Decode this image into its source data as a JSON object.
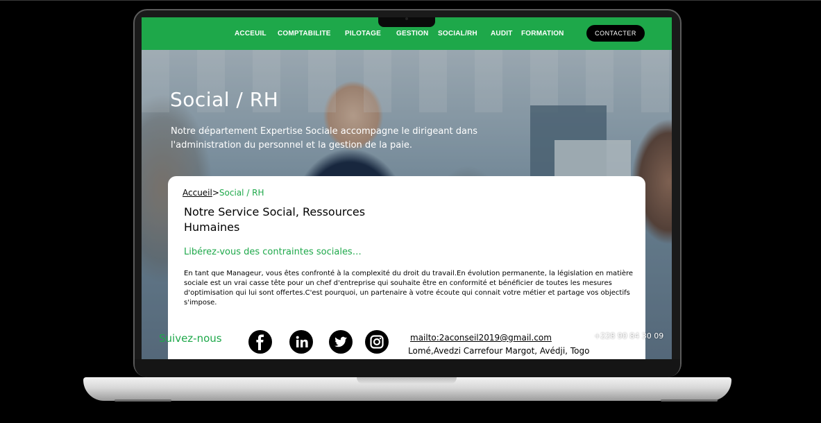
{
  "nav": {
    "items": [
      "ACCEUIL",
      "COMPTABILITE",
      "PILOTAGE",
      "GESTION",
      "SOCIAL/RH",
      "AUDIT",
      "FORMATION"
    ],
    "contact_label": "CONTACTER"
  },
  "hero": {
    "title": "Social / RH",
    "subtitle": "Notre département Expertise Sociale accompagne le dirigeant dans l'administration du personnel et la gestion de la paie."
  },
  "breadcrumb": {
    "home": "Accueil",
    "separator": ">",
    "current": "Social / RH"
  },
  "card": {
    "title": "Notre Service Social, Ressources Humaines",
    "tagline": "Libérez-vous des contraintes sociales…",
    "body": "En tant que Manageur, vous êtes confronté à la complexité du droit du travail.En évolution permanente, la législation en matière sociale est un vrai casse tête pour un chef d'entreprise qui souhaite être en conformité et bénéficier de toutes les mesures d'optimisation qui lui sont offertes.C'est pourquoi, un partenaire à votre écoute qui connait votre métier et partage vos objectifs s'impose."
  },
  "footer": {
    "follow_label": "Suivez-nous",
    "social_icons": [
      "facebook-icon",
      "linkedin-icon",
      "twitter-icon",
      "instagram-icon"
    ],
    "email": "mailto:2aconseil2019@gmail.com",
    "address": "Lomé,Avedzi Carrefour Margot, Avédji, Togo",
    "phone": "+228 90 84 30 09"
  },
  "colors": {
    "brand_green": "#1ea84a",
    "contact_button": "#000000"
  }
}
